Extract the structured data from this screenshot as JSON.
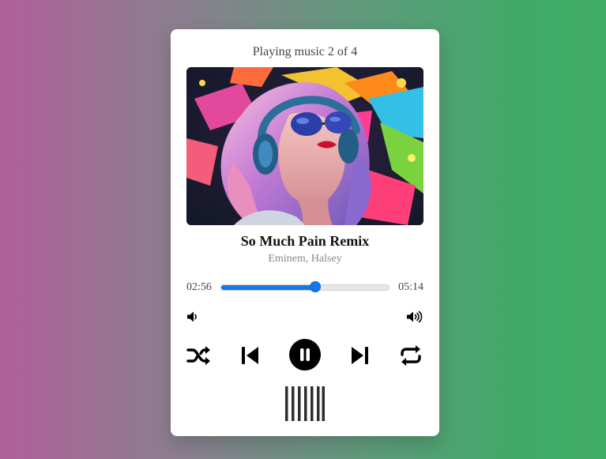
{
  "player": {
    "status_text": "Playing music 2 of 4",
    "song_title": "So Much Pain Remix",
    "artist": "Eminem, Halsey",
    "current_time": "02:56",
    "total_time": "05:14",
    "progress_fraction": 0.56,
    "state": "playing"
  },
  "icons": {
    "volume_down": "volume-low-icon",
    "volume_up": "volume-high-icon",
    "shuffle": "shuffle-icon",
    "previous": "skip-previous-icon",
    "play_pause": "pause-icon",
    "next": "skip-next-icon",
    "repeat": "repeat-icon",
    "visualizer": "equalizer-bars-icon"
  },
  "colors": {
    "accent": "#1677e8",
    "track": "#e6e6e6",
    "card": "#ffffff",
    "control": "#000000"
  }
}
